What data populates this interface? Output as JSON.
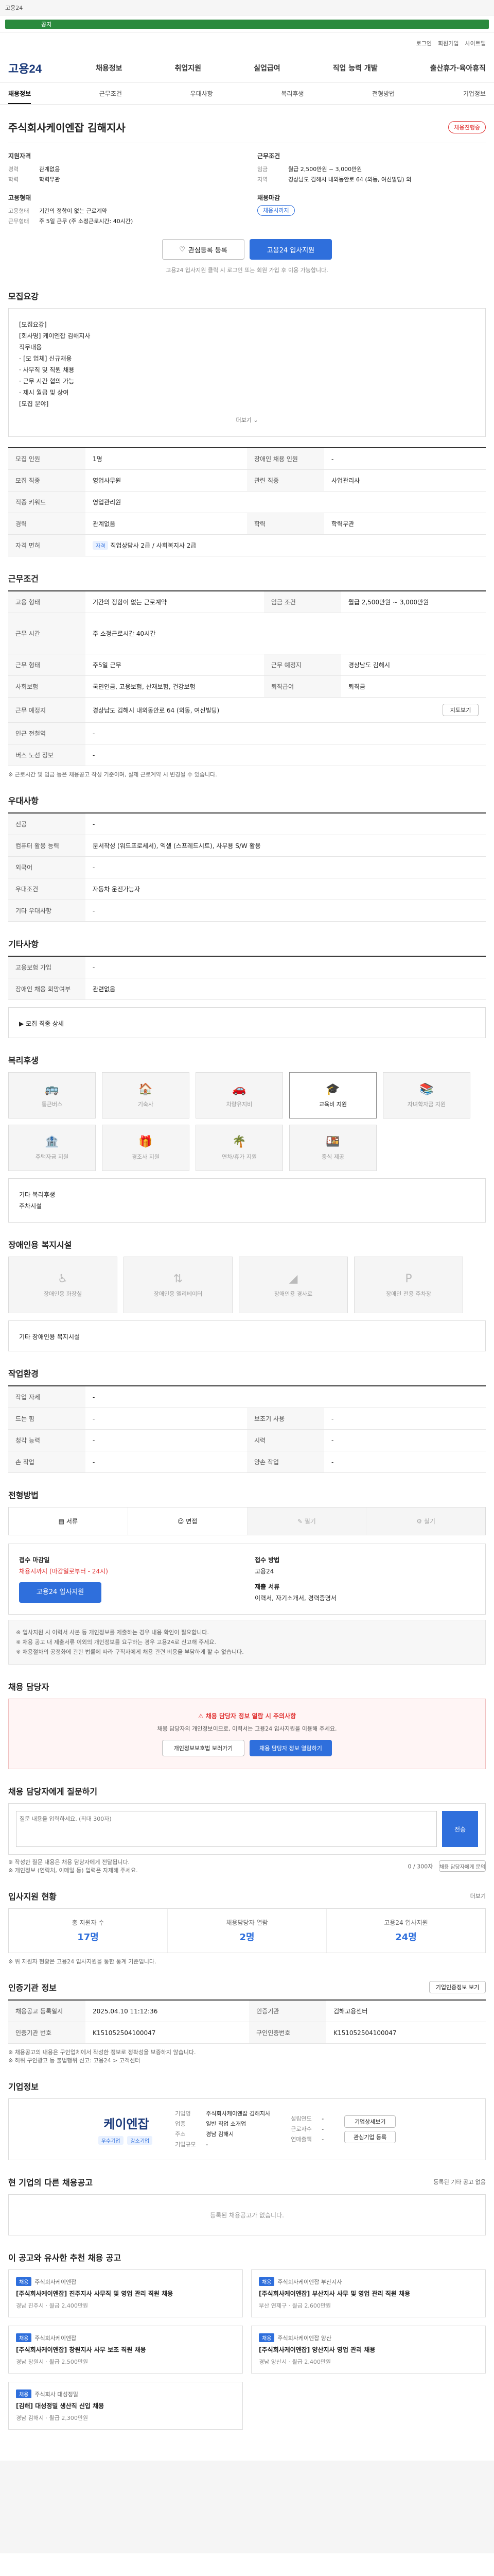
{
  "top": {
    "notice": "고용24",
    "ticker": "공지"
  },
  "util": [
    "로그인",
    "회원가입",
    "사이트맵"
  ],
  "brand": "고용24",
  "gnb": [
    "채용정보",
    "취업지원",
    "실업급여",
    "직업 능력 개발",
    "출산휴가·육아휴직"
  ],
  "tabs": [
    "채용정보",
    "근무조건",
    "우대사항",
    "복리후생",
    "전형방법",
    "기업정보"
  ],
  "company": {
    "name": "주식회사케이엔잡 김해지사",
    "badge": "채용진행중",
    "recruit_title": "지원자격",
    "recruit": [
      {
        "k": "경력",
        "v": "관계없음"
      },
      {
        "k": "학력",
        "v": "학력무관"
      }
    ],
    "cond_title": "근무조건",
    "cond": [
      {
        "k": "임금",
        "v": "월급 2,500만원 ~ 3,000만원"
      },
      {
        "k": "지역",
        "v": "경상남도 김해시 내외동안로 64 (외동, 여신빌딩) 외"
      }
    ],
    "form_title": "고용형태",
    "form": [
      {
        "k": "고용형태",
        "v": "기간의 정함이 없는 근로계약"
      },
      {
        "k": "근무형태",
        "v": "주 5일 근무 (주 소정근로시간: 40시간)"
      }
    ],
    "deadline_title": "채용마감",
    "deadline": "채용시까지",
    "scrap": "관심등록 등록",
    "apply": "고용24 입사지원",
    "note": "고용24 입사지원 클릭 시 로그인 또는 회원 가입 후 이용 가능합니다."
  },
  "s1": {
    "title": "모집요강",
    "body": [
      "[모집요강]",
      "[회사명] 케이엔잡 김해지사",
      "직무내용",
      "- [모 업체] 신규채용",
      "· 사무직 및 직원 채용",
      "· 근무 시간 협의 가능",
      "· 제시 월급 및 상여",
      "[모집 분야]"
    ],
    "more": "더보기"
  },
  "s1table": [
    {
      "k": "모집 인원",
      "v": "1명",
      "k2": "장애인 채용 인원",
      "v2": "-"
    },
    {
      "k": "모집 직종",
      "v": "영업사무원",
      "k2": "관련 직종",
      "v2": "사업관리사"
    },
    {
      "k": "직종 키워드",
      "v": "영업관리원",
      "k2": "",
      "v2": ""
    },
    {
      "k": "경력",
      "v": "관계없음",
      "k2": "학력",
      "v2": "학력무관"
    },
    {
      "k": "자격 면허",
      "v": "직업상담사 2급 / 사회복지사 2급",
      "k2": "",
      "v2": ""
    }
  ],
  "s2": {
    "title": "근무조건",
    "rows": [
      {
        "k": "고용 형태",
        "v": "기간의 정함이 없는 근로계약",
        "k2": "임금 조건",
        "v2": "월급 2,500만원 ~ 3,000만원"
      },
      {
        "k": "근무 시간",
        "v": "주 소정근로시간 40시간",
        "k2": "",
        "v2": ""
      },
      {
        "k": "근무 형태",
        "v": "주5일 근무",
        "k2": "근무 예정지",
        "v2": "경상남도 김해시"
      },
      {
        "k": "사회보험",
        "v": "국민연금, 고용보험, 산재보험, 건강보험",
        "k2": "퇴직급여",
        "v2": "퇴직금"
      },
      {
        "k": "근무 예정지",
        "v": "경상남도 김해시 내외동안로 64 (외동, 여신빌딩)",
        "k2": "",
        "v2": ""
      },
      {
        "k": "인근 전철역",
        "v": "-",
        "k2": "",
        "v2": ""
      },
      {
        "k": "버스 노선 정보",
        "v": "-",
        "k2": "",
        "v2": ""
      }
    ],
    "map_btn": "지도보기",
    "foot": "※ 근로시간 및 임금 등은 채용공고 작성 기준이며, 실제 근로계약 시 변경될 수 있습니다."
  },
  "s3": {
    "title": "우대사항",
    "rows": [
      {
        "k": "전공",
        "v": "-"
      },
      {
        "k": "컴퓨터 활용 능력",
        "v": "문서작성 (워드프로세서), 엑셀 (스프레드시트), 사무용 S/W 활용"
      },
      {
        "k": "외국어",
        "v": "-"
      },
      {
        "k": "우대조건",
        "v": "자동차 운전가능자"
      },
      {
        "k": "기타 우대사항",
        "v": "-"
      }
    ]
  },
  "s4": {
    "title": "기타사항",
    "rows": [
      {
        "k": "고용보험 가입",
        "v": "-"
      },
      {
        "k": "장애인 채용 희망여부",
        "v": "관련없음"
      }
    ],
    "extra": "▶ 모집 직종 상세"
  },
  "s5": {
    "title": "복리후생",
    "icons": [
      {
        "n": "통근버스",
        "on": false,
        "s": "🚌"
      },
      {
        "n": "기숙사",
        "on": false,
        "s": "🏠"
      },
      {
        "n": "차량유지비",
        "on": false,
        "s": "🚗"
      },
      {
        "n": "교육비 지원",
        "on": true,
        "s": "🎓"
      },
      {
        "n": "자녀학자금 지원",
        "on": false,
        "s": "📚"
      },
      {
        "n": "주택자금 지원",
        "on": false,
        "s": "🏦"
      },
      {
        "n": "경조사 지원",
        "on": false,
        "s": "🎁"
      },
      {
        "n": "연차/휴가 지원",
        "on": false,
        "s": "🌴"
      },
      {
        "n": "중식 제공",
        "on": false,
        "s": "🍱"
      }
    ],
    "note_label": "기타 복리후생",
    "note": "주차시설"
  },
  "s6": {
    "title": "장애인용 복지시설",
    "icons": [
      "장애인용 화장실",
      "장애인용 엘리베이터",
      "장애인용 경사로",
      "장애인 전용 주차장"
    ],
    "note": "기타 장애인용 복지시설"
  },
  "s7": {
    "title": "작업환경",
    "rows": [
      {
        "k": "작업 자세",
        "v": "-",
        "k2": "",
        "v2": ""
      },
      {
        "k": "드는 힘",
        "v": "-",
        "k2": "보조기 사용",
        "v2": "-"
      },
      {
        "k": "청각 능력",
        "v": "-",
        "k2": "시력",
        "v2": "-"
      },
      {
        "k": "손 작업",
        "v": "-",
        "k2": "양손 작업",
        "v2": "-"
      }
    ]
  },
  "s8": {
    "title": "전형방법",
    "steps": [
      "서류",
      "면접",
      "필기",
      "실기"
    ],
    "apply_title": "접수 마감일",
    "apply_deadline": "채용시까지 (마감일로부터 - 24시)",
    "apply_btn": "고용24 입사지원",
    "doc_title": "접수 방법",
    "doc": "고용24",
    "doc2_title": "제출 서류",
    "doc2": "이력서, 자기소개서, 경력증명서",
    "notes": [
      "※ 입사지원 시 이력서 사본 등 개인정보를 제출하는 경우 내용 확인이 필요합니다.",
      "※ 채용 공고 내 제출서류 이외의 개인정보를 요구하는 경우 고용24로 신고해 주세요.",
      "※ 채용절차의 공정화에 관한 법률에 따라 구직자에게 채용 관련 비용을 부담하게 할 수 없습니다."
    ]
  },
  "s9": {
    "title": "채용 담당자",
    "warn_a": "채용 담당자 정보 열람 시 주의사항",
    "warn_b": "채용 담당자의 개인정보이므로, 이력서는 고용24 입사지원을 이용해 주세요.",
    "btn_a": "개인정보보호법 보러가기",
    "btn_b": "채용 담당자 정보 열람하기"
  },
  "s10": {
    "title": "채용 담당자에게 질문하기",
    "placeholder": "질문 내용을 입력하세요. (최대 300자)",
    "send": "전송",
    "counter": "0 / 300자",
    "notes": [
      "※ 작성한 질문 내용은 채용 담당자에게 전달됩니다.",
      "※ 개인정보 (연락처, 이메일 등) 입력은 자제해 주세요."
    ],
    "link": "채용 담당자에게 문의"
  },
  "s11": {
    "title": "입사지원 현황",
    "more": "더보기",
    "stats": [
      {
        "l": "총 지원자 수",
        "n": "17명"
      },
      {
        "l": "채용담당자 열람",
        "n": "2명"
      },
      {
        "l": "고용24 입사지원",
        "n": "24명"
      }
    ],
    "note": "※ 위 지원자 현황은 고용24 입사지원을 통한 통계 기준입니다."
  },
  "s12": {
    "title": "인증기관 정보",
    "btn": "기업인증정보 보기",
    "rows": [
      {
        "k": "채용공고 등록일시",
        "v": "2025.04.10 11:12:36",
        "k2": "인증기관",
        "v2": "김해고용센터"
      },
      {
        "k": "인증기관 번호",
        "v": "K151052504100047",
        "k2": "구인인증번호",
        "v2": "K151052504100047"
      }
    ],
    "notes": [
      "※ 채용공고의 내용은 구인업체에서 작성한 정보로 정확성을 보증하지 않습니다.",
      "※ 허위 구인광고 등 불법행위 신고: 고용24 > 고객센터"
    ]
  },
  "s13": {
    "title": "기업정보",
    "logo": "케이엔잡",
    "rows": [
      {
        "k": "기업명",
        "v": "주식회사케이엔잡 김해지사"
      },
      {
        "k": "업종",
        "v": "일반 직업 소개업"
      },
      {
        "k": "주소",
        "v": "경남 김해시"
      },
      {
        "k": "기업규모",
        "v": "-"
      }
    ],
    "rows2": [
      {
        "k": "설립연도",
        "v": "-"
      },
      {
        "k": "근로자수",
        "v": "-"
      },
      {
        "k": "연매출액",
        "v": "-"
      }
    ],
    "btns": [
      "기업상세보기",
      "관심기업 등록"
    ],
    "chips": [
      "우수기업",
      "강소기업"
    ]
  },
  "s14": {
    "title": "현 기업의 다른 채용공고",
    "empty": "등록된 채용공고가 없습니다.",
    "sub": "등록된 기타 공고 없음"
  },
  "s15": {
    "title": "이 공고와 유사한 추천 채용 공고",
    "cards": [
      {
        "co": "주식회사케이엔잡",
        "t": "[주식회사케이엔잡] 진주지사 사무직 및 영업 관리 직원 채용",
        "m": "경남 진주시 · 월급 2,400만원"
      },
      {
        "co": "주식회사케이엔잡 부산지사",
        "t": "[주식회사케이엔잡] 부산지사 사무 및 영업 관리 직원 채용",
        "m": "부산 연제구 · 월급 2,600만원"
      },
      {
        "co": "주식회사케이엔잡",
        "t": "[주식회사케이엔잡] 창원지사 사무 보조 직원 채용",
        "m": "경남 창원시 · 월급 2,500만원"
      },
      {
        "co": "주식회사케이엔잡 양산",
        "t": "[주식회사케이엔잡] 양산지사 영업 관리 채용",
        "m": "경남 양산시 · 월급 2,400만원"
      },
      {
        "co": "주식회사 대성정밀",
        "t": "[김해] 대성정밀 생산직 신입 채용",
        "m": "경남 김해시 · 월급 2,300만원"
      }
    ]
  }
}
